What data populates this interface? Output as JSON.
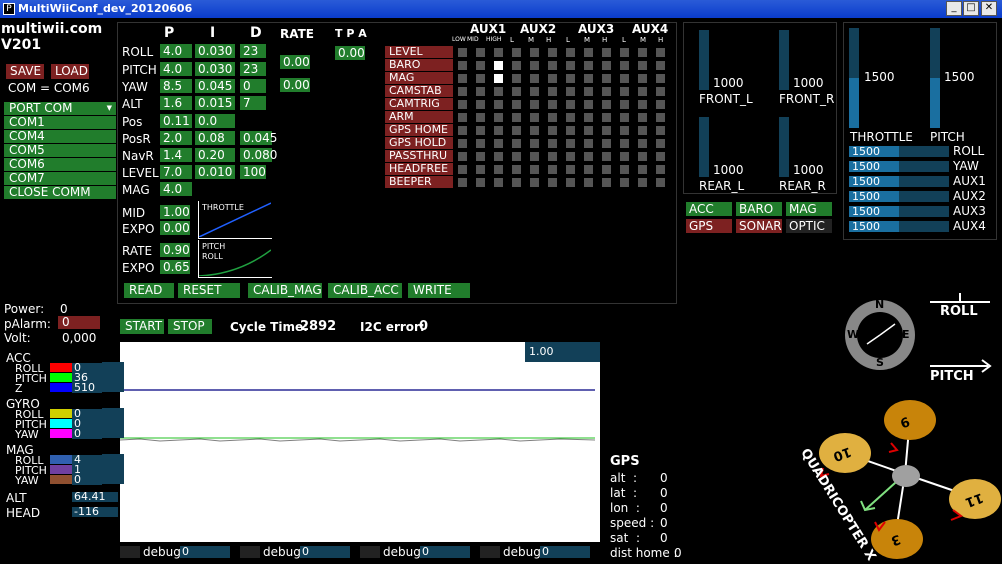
{
  "window": {
    "title": "MultiWiiConf_dev_20120606"
  },
  "app": {
    "brand": "multiwii.com",
    "version": "V201"
  },
  "serial": {
    "save_label": "SAVE",
    "load_label": "LOAD",
    "com_status": "COM = COM6",
    "port_header": "PORT COM",
    "ports": [
      "COM1",
      "COM4",
      "COM5",
      "COM6",
      "COM7"
    ],
    "close_label": "CLOSE COMM"
  },
  "pid": {
    "headers": {
      "p": "P",
      "i": "I",
      "d": "D",
      "rate": "RATE",
      "tpa": "T P A"
    },
    "rows": [
      {
        "name": "ROLL",
        "p": "4.0",
        "i": "0.030",
        "d": "23"
      },
      {
        "name": "PITCH",
        "p": "4.0",
        "i": "0.030",
        "d": "23"
      },
      {
        "name": "YAW",
        "p": "8.5",
        "i": "0.045",
        "d": "0"
      },
      {
        "name": "ALT",
        "p": "1.6",
        "i": "0.015",
        "d": "7"
      },
      {
        "name": "Pos",
        "p": "0.11",
        "i": "0.0",
        "d": ""
      },
      {
        "name": "PosR",
        "p": "2.0",
        "i": "0.08",
        "d": "0.045"
      },
      {
        "name": "NavR",
        "p": "1.4",
        "i": "0.20",
        "d": "0.080"
      },
      {
        "name": "LEVEL",
        "p": "7.0",
        "i": "0.010",
        "d": "100"
      },
      {
        "name": "MAG",
        "p": "4.0",
        "i": "",
        "d": ""
      }
    ],
    "rate_rp": "0.00",
    "rate_yaw": "0.00",
    "tpa": "0.00"
  },
  "throttle_expo": {
    "mid_label": "MID",
    "mid": "1.00",
    "expo_label": "EXPO",
    "expo": "0.00",
    "graph_label": "THROTTLE"
  },
  "rate_expo": {
    "rate_label": "RATE",
    "rate": "0.90",
    "expo_label": "EXPO",
    "expo": "0.65",
    "graph_label1": "PITCH",
    "graph_label2": "ROLL"
  },
  "actions": {
    "read": "READ",
    "reset": "RESET",
    "calib_mag": "CALIB_MAG",
    "calib_acc": "CALIB_ACC",
    "write": "WRITE"
  },
  "aux": {
    "headers": [
      "AUX1",
      "AUX2",
      "AUX3",
      "AUX4"
    ],
    "sub_first": [
      "LOW",
      "MID",
      "HIGH"
    ],
    "sub": [
      "L",
      "M",
      "H"
    ],
    "boxes": [
      "LEVEL",
      "BARO",
      "MAG",
      "CAMSTAB",
      "CAMTRIG",
      "ARM",
      "GPS HOME",
      "GPS HOLD",
      "PASSTHRU",
      "HEADFREE",
      "BEEPER"
    ],
    "checked": [
      [
        1,
        2
      ],
      [
        2,
        2
      ]
    ]
  },
  "motors": [
    {
      "label": "FRONT_L",
      "value": "1000",
      "level": 0.0
    },
    {
      "label": "FRONT_R",
      "value": "1000",
      "level": 0.0
    },
    {
      "label": "REAR_L",
      "value": "1000",
      "level": 0.0
    },
    {
      "label": "REAR_R",
      "value": "1000",
      "level": 0.0
    }
  ],
  "sensors_status": [
    {
      "label": "ACC",
      "on": true
    },
    {
      "label": "BARO",
      "on": true
    },
    {
      "label": "MAG",
      "on": true
    },
    {
      "label": "GPS",
      "on": false
    },
    {
      "label": "SONAR",
      "on": false
    },
    {
      "label": "OPTIC",
      "on": false
    }
  ],
  "rc": {
    "throttle": {
      "label": "THROTTLE",
      "value": "1500",
      "level": 0.5
    },
    "pitch": {
      "label": "PITCH",
      "value": "1500",
      "level": 0.5
    },
    "channels": [
      {
        "name": "ROLL",
        "value": "1500",
        "level": 0.5
      },
      {
        "name": "YAW",
        "value": "1500",
        "level": 0.5
      },
      {
        "name": "AUX1",
        "value": "1500",
        "level": 0.5
      },
      {
        "name": "AUX2",
        "value": "1500",
        "level": 0.5
      },
      {
        "name": "AUX3",
        "value": "1500",
        "level": 0.5
      },
      {
        "name": "AUX4",
        "value": "1500",
        "level": 0.5
      }
    ]
  },
  "power": {
    "power_label": "Power:",
    "power": "0",
    "palarm_label": "pAlarm:",
    "palarm": "0",
    "volt_label": "Volt:",
    "volt": "0,000"
  },
  "monitor": {
    "start": "START",
    "stop": "STOP",
    "cycle_label": "Cycle Time:",
    "cycle": "2892",
    "i2c_label": "I2C error:",
    "i2c": "0",
    "scale": "1.00"
  },
  "sensors": {
    "acc": {
      "title": "ACC",
      "rows": [
        {
          "name": "ROLL",
          "value": "0",
          "color": "#ff0000"
        },
        {
          "name": "PITCH",
          "value": "36",
          "color": "#00ff00"
        },
        {
          "name": "Z",
          "value": "510",
          "color": "#0000ff"
        }
      ]
    },
    "gyro": {
      "title": "GYRO",
      "rows": [
        {
          "name": "ROLL",
          "value": "0",
          "color": "#d0d000"
        },
        {
          "name": "PITCH",
          "value": "0",
          "color": "#00ffff"
        },
        {
          "name": "YAW",
          "value": "0",
          "color": "#ff00ff"
        }
      ]
    },
    "mag": {
      "title": "MAG",
      "rows": [
        {
          "name": "ROLL",
          "value": "4",
          "color": "#3060b0"
        },
        {
          "name": "PITCH",
          "value": "1",
          "color": "#7040a0"
        },
        {
          "name": "YAW",
          "value": "0",
          "color": "#905030"
        }
      ]
    },
    "alt_label": "ALT",
    "alt": "64.41",
    "head_label": "HEAD",
    "head": "-116"
  },
  "debug": [
    {
      "label": "debug",
      "value": "0"
    },
    {
      "label": "debug",
      "value": "0"
    },
    {
      "label": "debug",
      "value": "0"
    },
    {
      "label": "debug",
      "value": "0"
    }
  ],
  "gps": {
    "title": "GPS",
    "rows": [
      {
        "label": "alt  :",
        "value": "0"
      },
      {
        "label": "lat  :",
        "value": "0"
      },
      {
        "label": "lon  :",
        "value": "0"
      },
      {
        "label": "speed :",
        "value": "0"
      },
      {
        "label": "sat  :",
        "value": "0"
      },
      {
        "label": "dist home :",
        "value": "0"
      }
    ]
  },
  "compass": {
    "n": "N",
    "s": "S",
    "e": "E",
    "w": "W"
  },
  "attitude": {
    "roll_label": "ROLL",
    "pitch_label": "PITCH"
  },
  "quad": {
    "label": "QUADRICOPTER X",
    "motors": [
      "9",
      "10",
      "11",
      "3"
    ]
  },
  "colors": {
    "green": "#217d2c",
    "red": "#7d2121",
    "meter": "#124058",
    "meter_fill": "#1a6fa0"
  }
}
